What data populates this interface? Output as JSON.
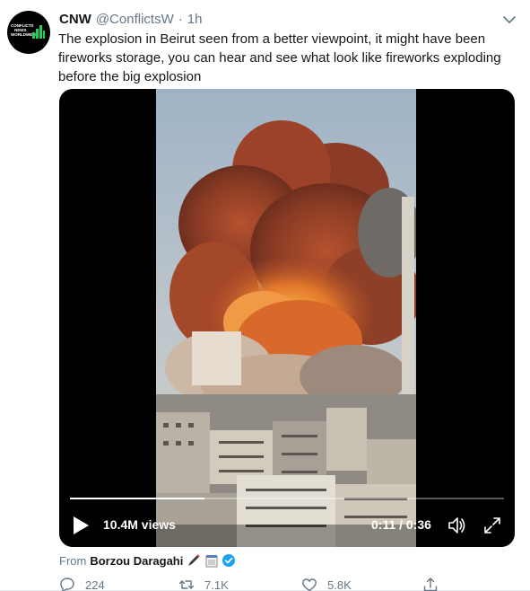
{
  "tweet": {
    "author_name": "CNW",
    "author_handle": "@ConflictsW",
    "separator": "·",
    "timestamp": "1h",
    "avatar_lines": [
      "CONFLICTS",
      "NEWS",
      "WORLDWIDE"
    ],
    "text": "The explosion in Beirut seen from a better viewpoint, it might have been fireworks storage, you can hear and see what look like fireworks exploding before the big explosion"
  },
  "video": {
    "views": "10.4M views",
    "time_readout": "0:11 / 0:36",
    "progress_fraction": 0.31,
    "icons": [
      "play-icon",
      "volume-icon",
      "fullscreen-icon"
    ]
  },
  "attribution": {
    "from_label": "From",
    "name": "Borzou Daragahi",
    "emojis": [
      "pen-icon",
      "notepad-icon"
    ],
    "verified": true
  },
  "actions": {
    "reply_count": "224",
    "retweet_count": "7.1K",
    "like_count": "5.8K",
    "icons": [
      "reply-icon",
      "retweet-icon",
      "like-icon",
      "share-icon"
    ]
  },
  "colors": {
    "link_blue": "#1da1f2",
    "secondary_text": "#657786",
    "primary_text": "#14171a",
    "green": "#17bf63"
  }
}
